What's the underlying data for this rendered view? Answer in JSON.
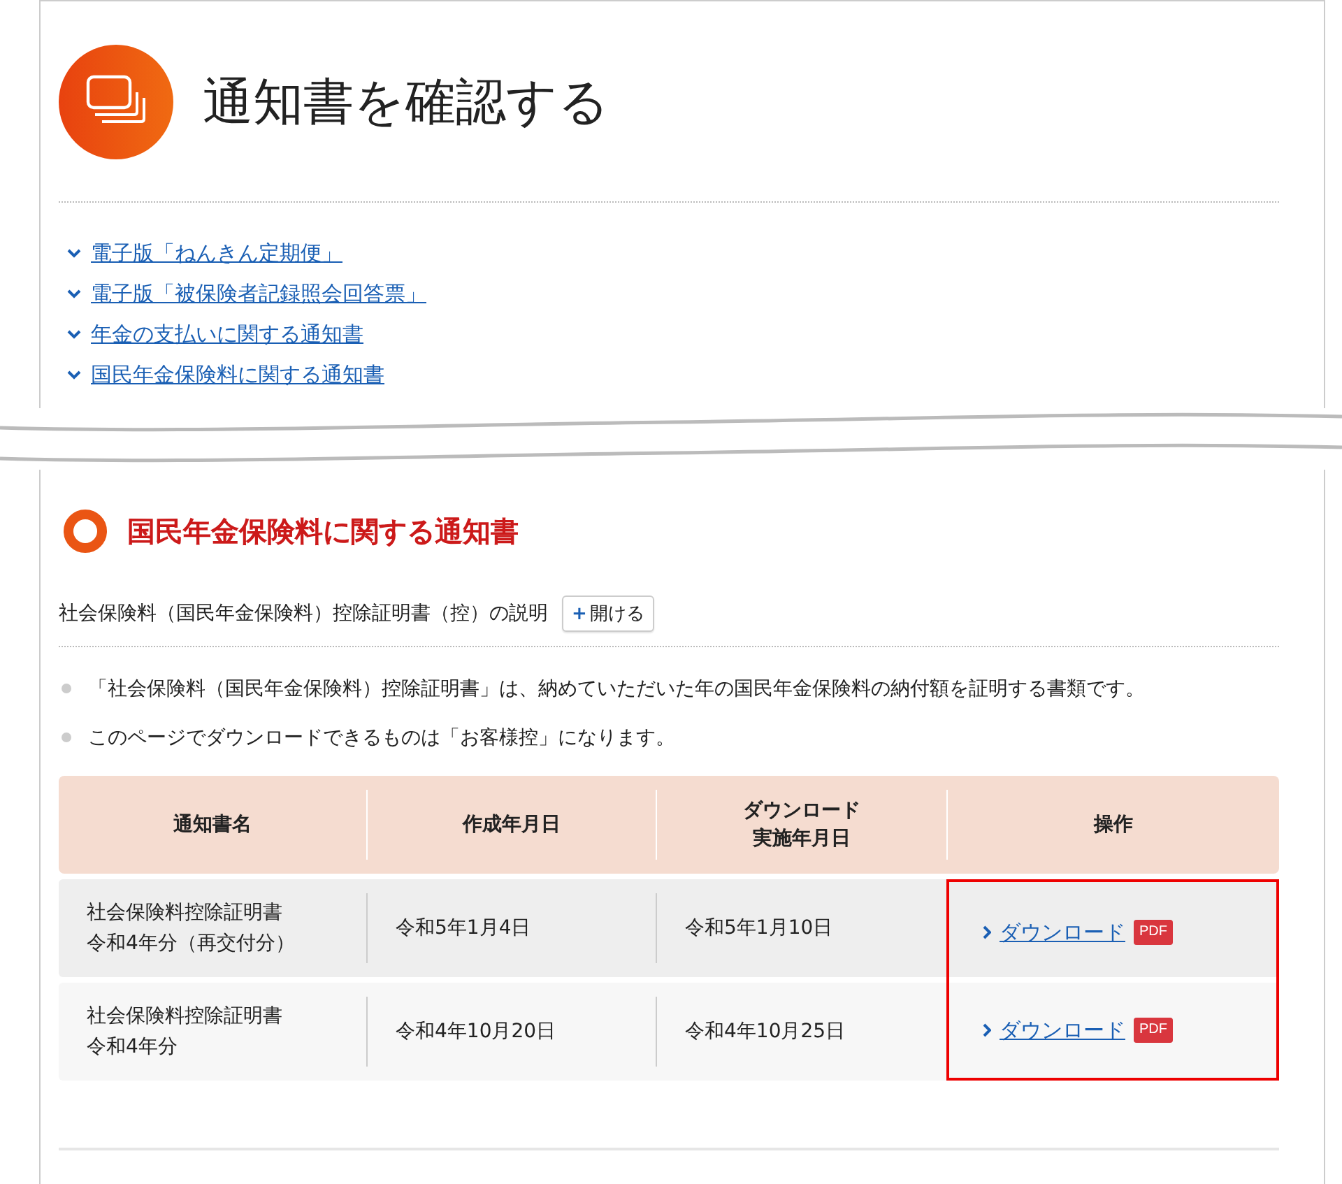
{
  "page_title": "通知書を確認する",
  "anchor_links": [
    {
      "label": "電子版「ねんきん定期便」"
    },
    {
      "label": "電子版「被保険者記録照会回答票」"
    },
    {
      "label": "年金の支払いに関する通知書"
    },
    {
      "label": "国民年金保険料に関する通知書"
    }
  ],
  "section": {
    "heading": "国民年金保険料に関する通知書",
    "explanation": {
      "label": "社会保険料（国民年金保険料）控除証明書（控）の説明",
      "button_icon": "+",
      "button_label": "開ける"
    },
    "notes": [
      "「社会保険料（国民年金保険料）控除証明書」は、納めていただいた年の国民年金保険料の納付額を証明する書類です。",
      "このページでダウンロードできるものは「お客様控」になります。"
    ],
    "table": {
      "columns": [
        {
          "label": "通知書名",
          "highlighted": false
        },
        {
          "label": "作成年月日",
          "highlighted": false
        },
        {
          "label": "ダウンロード実施年月日",
          "highlighted": false
        },
        {
          "label": "操作",
          "highlighted": true
        }
      ],
      "rows": [
        {
          "name": "社会保険料控除証明書令和4年分（再交付分）",
          "created": "令和5年1月4日",
          "downloaded": "令和5年1月10日",
          "action": "ダウンロード",
          "badge": "PDF"
        },
        {
          "name": "社会保険料控除証明書令和4年分",
          "created": "令和4年10月20日",
          "downloaded": "令和4年10月25日",
          "action": "ダウンロード",
          "badge": "PDF"
        }
      ]
    }
  }
}
